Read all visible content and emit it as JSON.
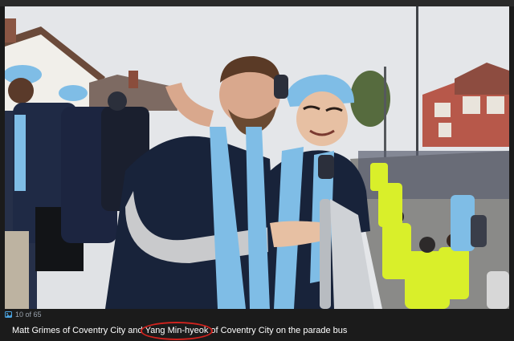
{
  "gallery": {
    "counter": "10 of 65",
    "icon": "gallery-icon"
  },
  "caption": {
    "part1": "Matt Grimes of Coventry City and ",
    "highlighted_name": "Yang Min-hyeok",
    "part2": " of Coventry City on the parade bus",
    "highlight_color": "#d0231e"
  },
  "colors": {
    "sky_blue": "#7fbde6",
    "navy": "#18233a",
    "hi_vis": "#d9ef2a"
  }
}
